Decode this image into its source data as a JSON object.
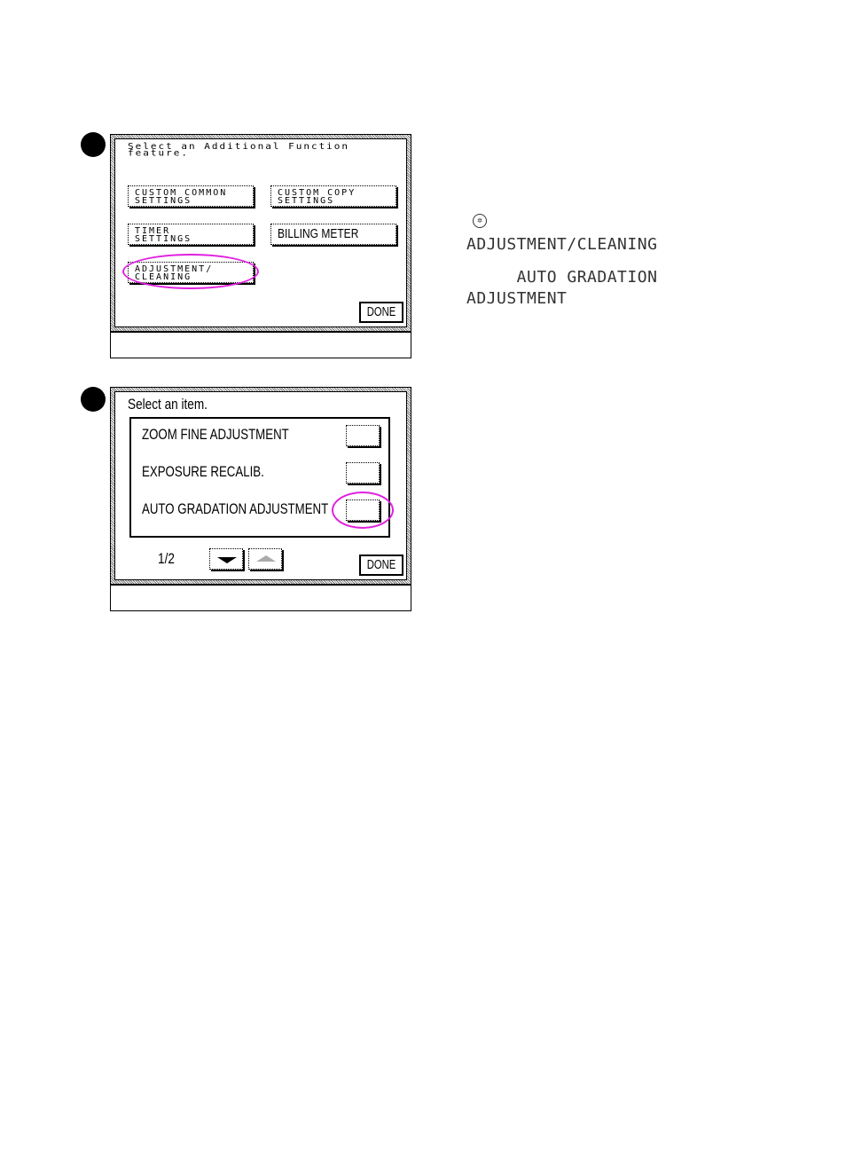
{
  "step1": {
    "screen": {
      "title_line1": "Select an Additional Function",
      "title_line2": "feature.",
      "buttons": [
        {
          "line1": "CUSTOM COMMON",
          "line2": "SETTINGS"
        },
        {
          "line1": "CUSTOM COPY",
          "line2": "SETTINGS"
        },
        {
          "line1": "TIMER",
          "line2": "SETTINGS"
        },
        {
          "label": "BILLING METER"
        },
        {
          "line1": "ADJUSTMENT/",
          "line2": "CLEANING"
        }
      ],
      "done_label": "DONE"
    }
  },
  "step2": {
    "screen": {
      "title": "Select an item.",
      "items": [
        {
          "label": "ZOOM FINE ADJUSTMENT"
        },
        {
          "label": "EXPOSURE RECALIB."
        },
        {
          "label": "AUTO GRADATION ADJUSTMENT"
        }
      ],
      "page_indicator": "1/2",
      "done_label": "DONE"
    }
  },
  "instructions": {
    "key_icon": "additional-functions-key",
    "key_glyph": "✲",
    "line1": "ADJUSTMENT/CLEANING",
    "line2": "     AUTO GRADATION",
    "line3": "ADJUSTMENT"
  },
  "colors": {
    "highlight": "#e020e0"
  }
}
